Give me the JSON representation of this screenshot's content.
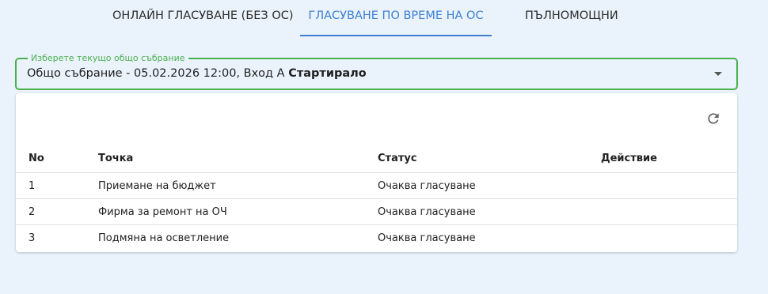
{
  "tabs": [
    {
      "label": "ОНЛАЙН ГЛАСУВАНЕ (БЕЗ ОС)",
      "active": false
    },
    {
      "label": "ГЛАСУВАНЕ ПО ВРЕМЕ НА ОС",
      "active": true
    },
    {
      "label": "ПЪЛНОМОЩНИ",
      "active": false
    }
  ],
  "assembly_select": {
    "label": "Изберете текущо общо събрание",
    "value_text": "Общо събрание - 05.02.2026 12:00, Вход А",
    "value_status": "Стартирало"
  },
  "table": {
    "columns": [
      "No",
      "Точка",
      "Статус",
      "Действие"
    ],
    "rows": [
      {
        "no": "1",
        "item": "Приемане на бюджет",
        "status": "Очаква гласуване",
        "action": ""
      },
      {
        "no": "2",
        "item": "Фирма за ремонт на ОЧ",
        "status": "Очаква гласуване",
        "action": ""
      },
      {
        "no": "3",
        "item": "Подмяна на осветление",
        "status": "Очаква гласуване",
        "action": ""
      }
    ]
  },
  "icons": {
    "refresh": "refresh-icon",
    "dropdown": "chevron-down-icon"
  },
  "colors": {
    "accent": "#3d7fd1",
    "focus_green": "#4caf50",
    "background": "#eaf3fc"
  }
}
